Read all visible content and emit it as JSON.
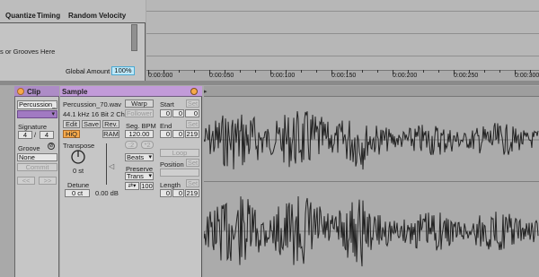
{
  "groove_pool": {
    "columns": [
      "Quantize",
      "Timing",
      "Random",
      "Velocity"
    ],
    "hint_text": "s or Grooves Here",
    "global_amount_label": "Global Amount",
    "global_amount_value": "100%"
  },
  "ruler": {
    "labels": [
      "0:00:000",
      "0:00:050",
      "0:00:100",
      "0:00:150",
      "0:00:200",
      "0:00:250",
      "0:00:300"
    ]
  },
  "clip": {
    "header": "Clip",
    "name": "Percussion_7",
    "signature_label": "Signature",
    "signature_num": "4",
    "signature_den": "4",
    "groove_label": "Groove",
    "groove_value": "None",
    "commit_label": "Commit",
    "nudge_back": "<<",
    "nudge_fwd": ">>"
  },
  "sample": {
    "header": "Sample",
    "file_name": "Percussion_70.wav",
    "format": "44.1 kHz 16 Bit 2 Ch",
    "edit_label": "Edit",
    "save_label": "Save",
    "rev_label": "Rev.",
    "hiq_label": "HiQ",
    "ram_label": "RAM",
    "transpose_label": "Transpose",
    "transpose_value": "0 st",
    "detune_label": "Detune",
    "detune_value": "0 ct",
    "gain_value": "0.00 dB",
    "warp_label": "Warp",
    "follower_label": "Follower",
    "seg_bpm_label": "Seg. BPM",
    "seg_bpm_value": "120.00",
    "half_label": ":2",
    "double_label": "*2",
    "warp_mode": "Beats",
    "preserve_label": "Preserve",
    "preserve_value": "Trans",
    "loop_mode_value": "100",
    "start_label": "Start",
    "end_label": "End",
    "loop_label": "Loop",
    "position_label": "Position",
    "length_label": "Length",
    "set_label": "Set",
    "start_values": [
      "0",
      "0",
      "0"
    ],
    "end_values": [
      "0",
      "0",
      "219"
    ],
    "length_values": [
      "0",
      "0",
      "219"
    ]
  },
  "colors": {
    "clip_header": "#ad8cc6",
    "sample_header": "#c29bd9",
    "hiq_active": "#f7a94a",
    "global_amount_bg": "#bfe8f8"
  }
}
